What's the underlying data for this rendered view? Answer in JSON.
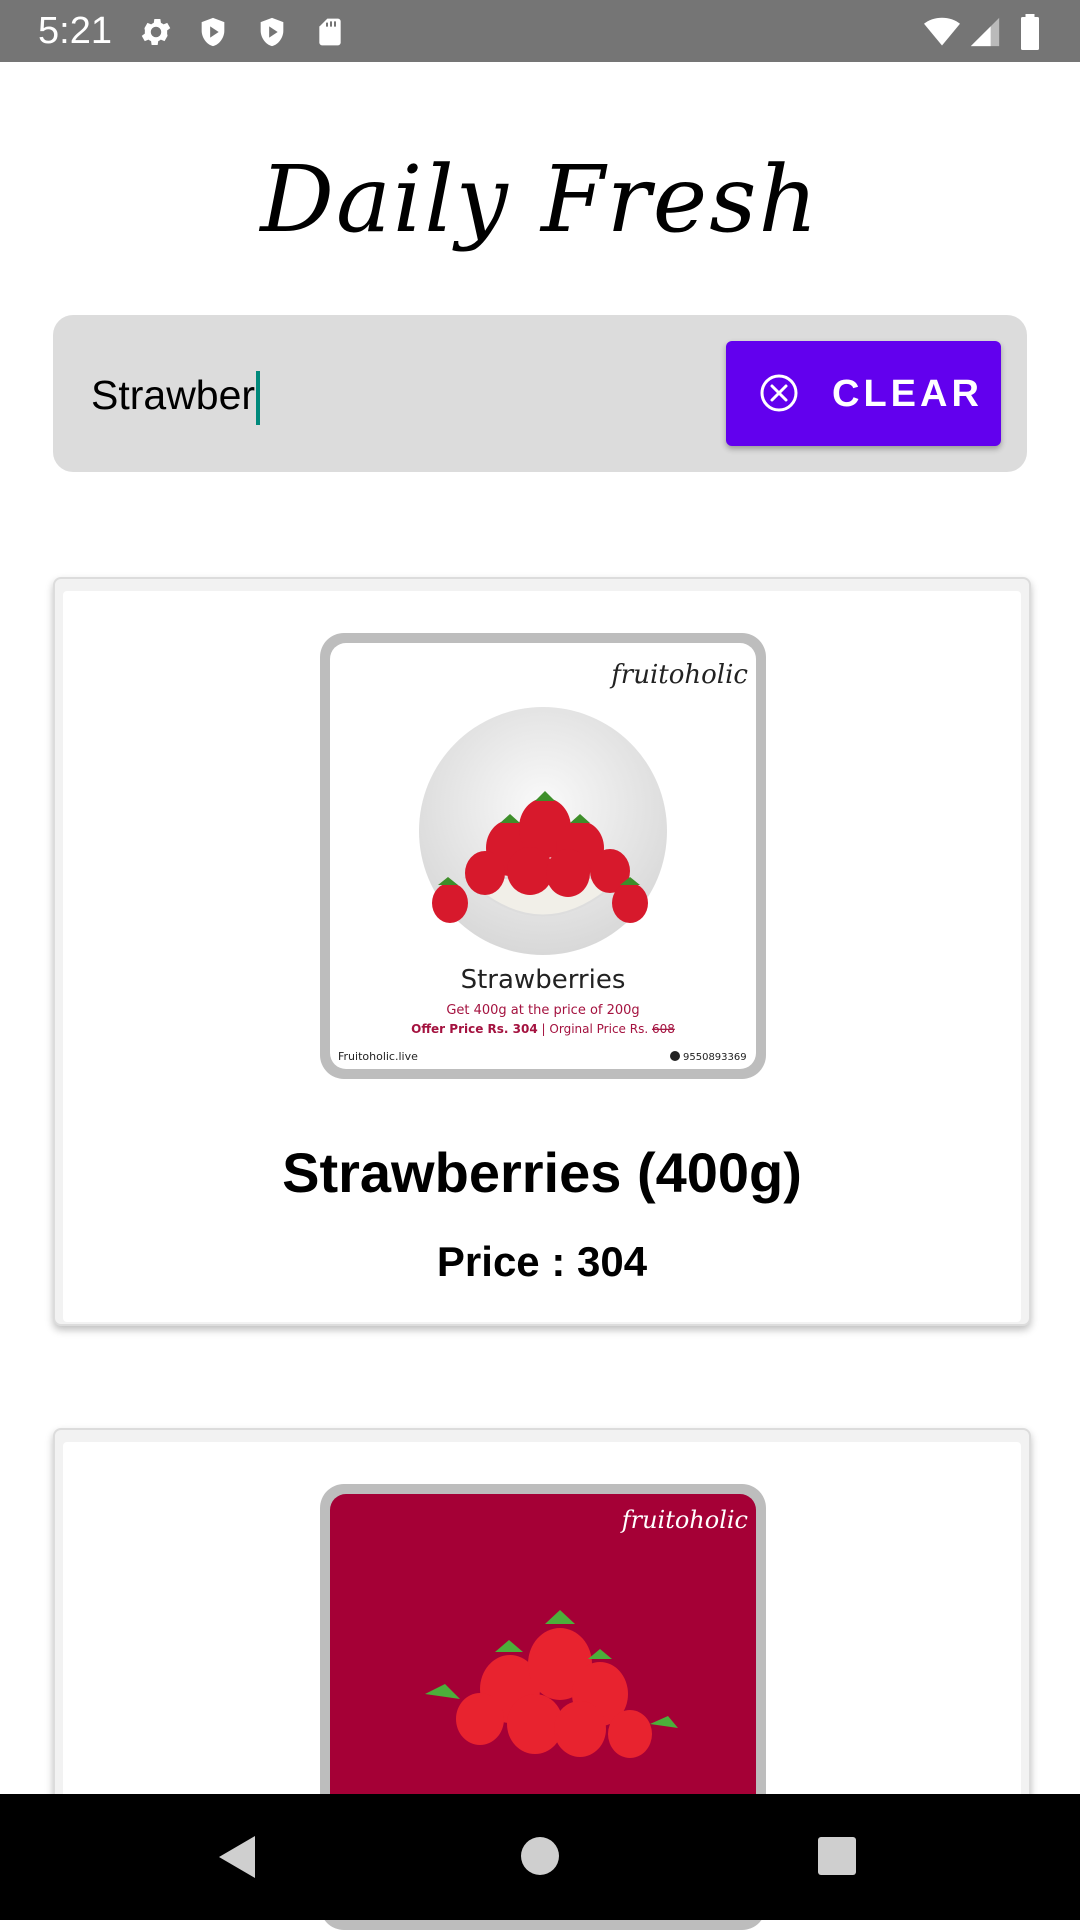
{
  "status_bar": {
    "time": "5:21",
    "left_icons": [
      "settings-icon",
      "shield-icon",
      "play-shield-icon",
      "sd-card-icon"
    ],
    "right_icons": [
      "wifi-icon",
      "cell-signal-icon",
      "battery-icon"
    ]
  },
  "app": {
    "title": "Daily Fresh"
  },
  "search": {
    "value": "Strawber"
  },
  "clear_button": {
    "label": "CLEAR",
    "icon": "close-circle-icon"
  },
  "products": [
    {
      "name": "Strawberries (400g)",
      "price": "Price : 304",
      "image": {
        "brand": "fruitoholic",
        "heading": "Strawberries",
        "line1": "Get 400g at the price of 200g",
        "offer": "Offer Price Rs. 304",
        "separator": "|",
        "original": "Orginal Price Rs.",
        "original_value": "608",
        "website": "Fruitoholic.live",
        "phone": "9550893369"
      }
    },
    {
      "image": {
        "brand": "fruitoholic"
      }
    }
  ],
  "nav_bar": {
    "buttons": [
      "back-icon",
      "home-icon",
      "recents-icon"
    ]
  },
  "colors": {
    "accent": "#6200ee",
    "status_bar": "#757575",
    "search_bg": "#dcdcdc",
    "caret": "#00897b",
    "offer_text": "#a4123f",
    "card2_bg": "#a50036"
  }
}
